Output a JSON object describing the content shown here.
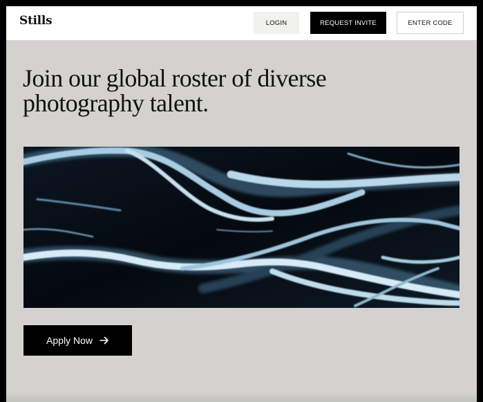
{
  "brand": {
    "name": "Stills"
  },
  "nav": {
    "login": "LOGIN",
    "request_invite": "REQUEST INVITE",
    "enter_code": "ENTER CODE"
  },
  "hero": {
    "headline": "Join our global roster of diverse photography talent.",
    "image_subject": "abstract aerial photograph of icy blue river channels on dark ground"
  },
  "cta": {
    "apply_label": "Apply Now",
    "apply_icon": "arrow-right-icon"
  },
  "colors": {
    "page_background": "#d3d2ce",
    "header_background": "#ffffff",
    "primary_button": "#000000",
    "secondary_button": "#f1f1f0"
  }
}
